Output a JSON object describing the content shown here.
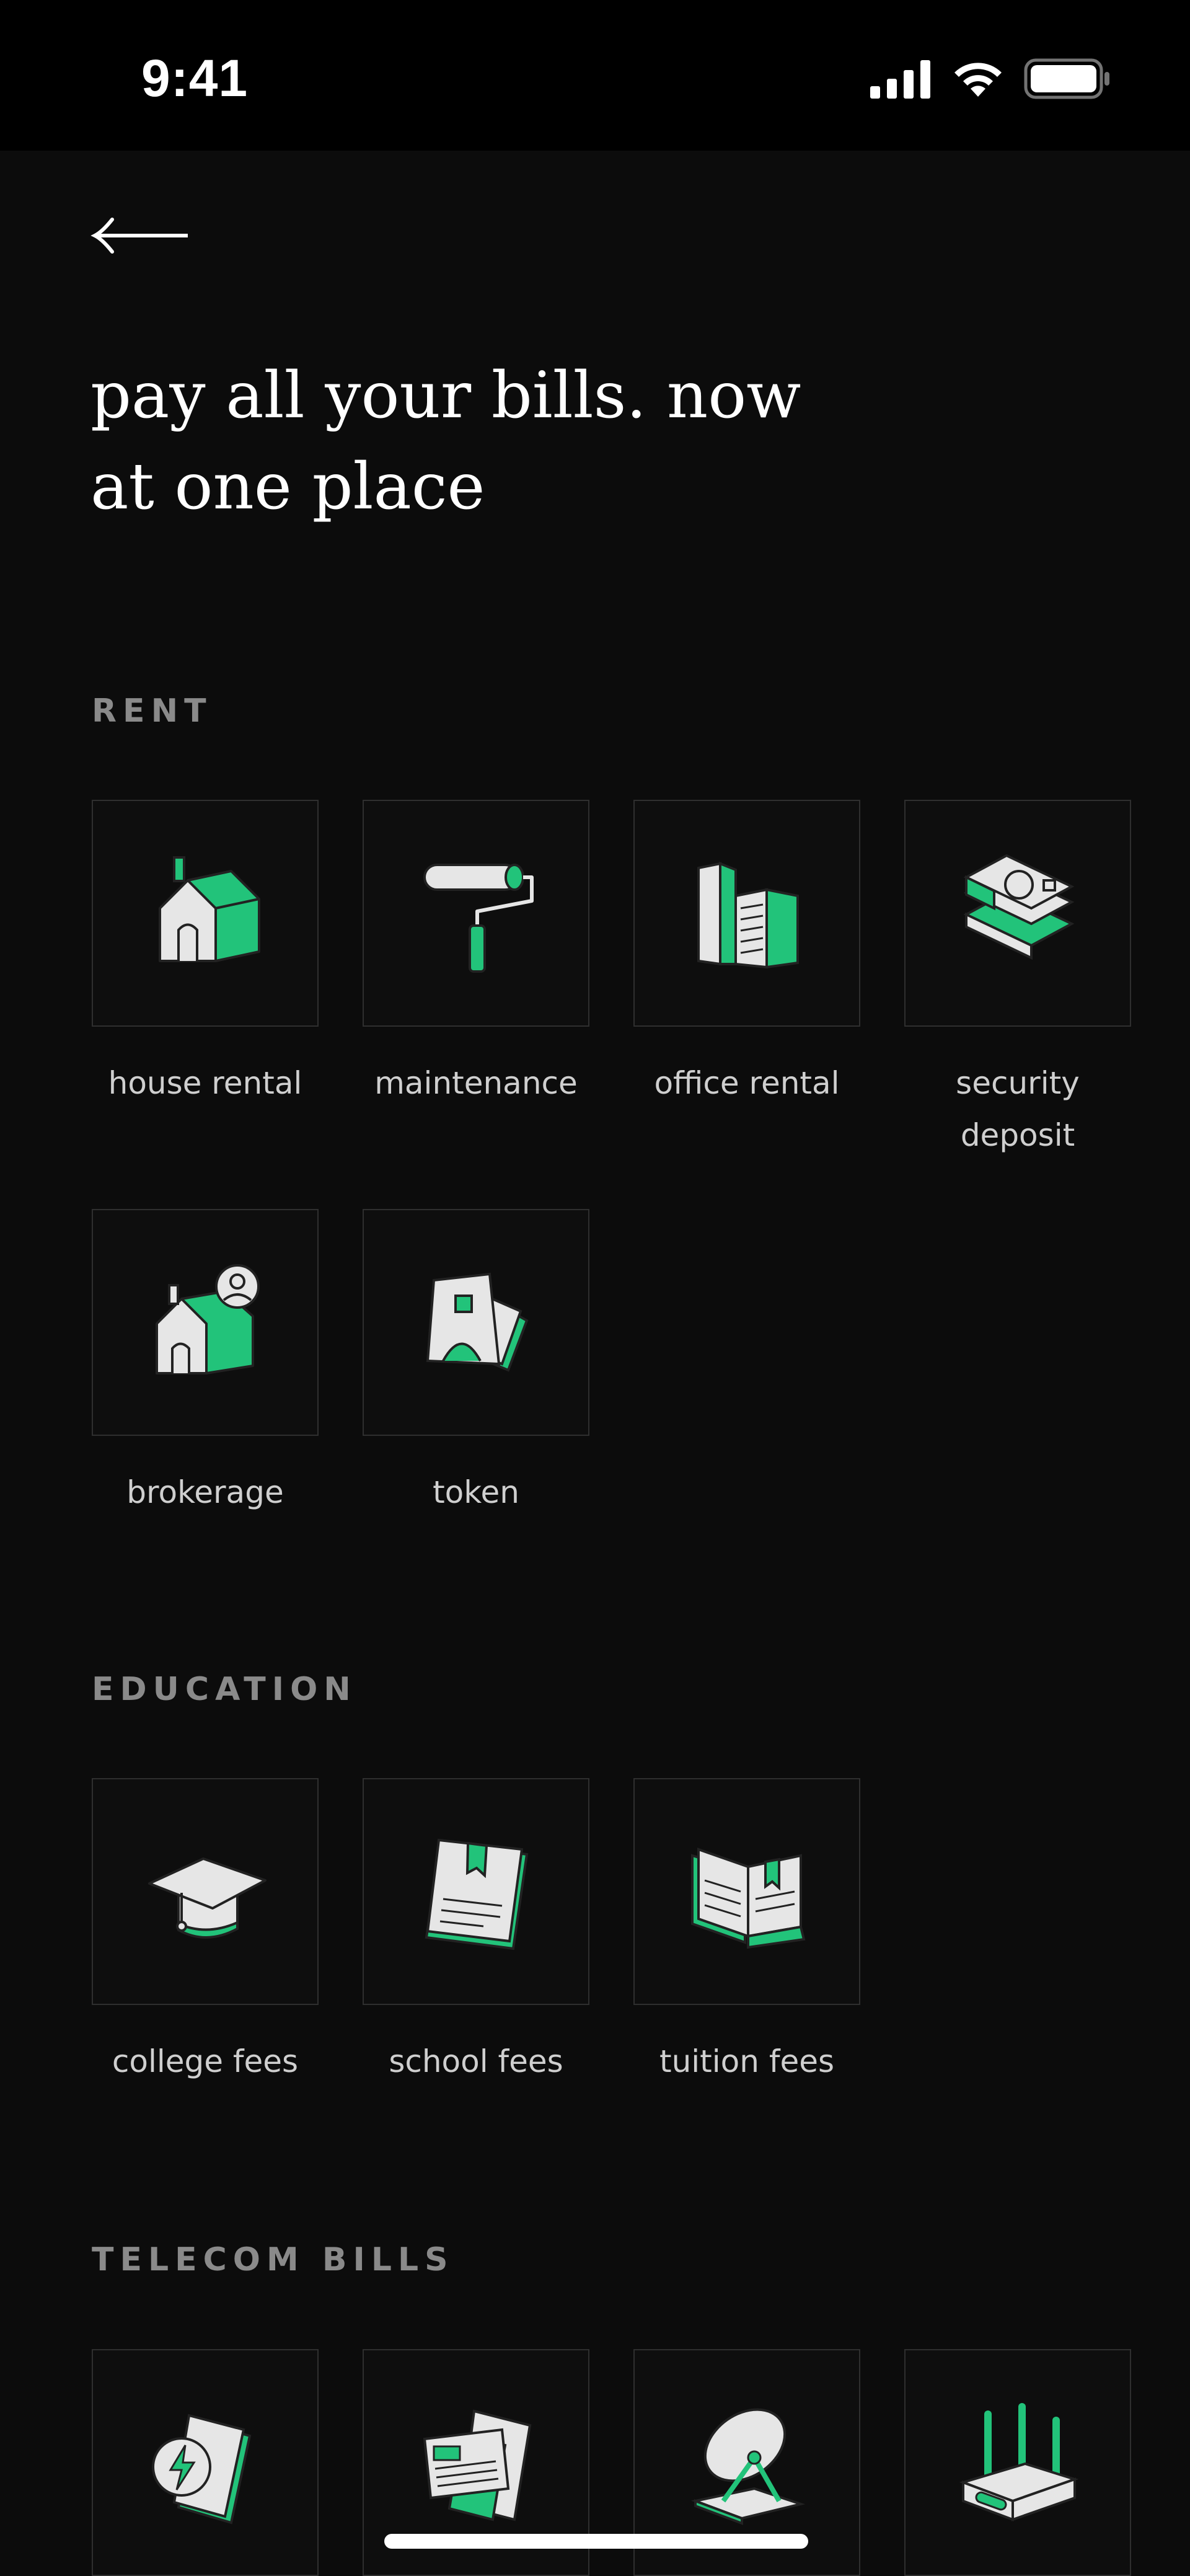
{
  "status_bar": {
    "time": "9:41"
  },
  "header": {
    "back_icon": "arrow-left-icon",
    "headline_line1": "pay all your bills. now",
    "headline_line2": "at one place"
  },
  "sections": {
    "rent": {
      "title": "RENT",
      "items": [
        {
          "label": "house rental",
          "icon": "house-icon"
        },
        {
          "label": "maintenance",
          "icon": "paint-roller-icon"
        },
        {
          "label": "office rental",
          "icon": "office-building-icon"
        },
        {
          "label_line1": "security",
          "label_line2": "deposit",
          "icon": "cash-stack-icon"
        },
        {
          "label": "brokerage",
          "icon": "house-person-icon"
        },
        {
          "label": "token",
          "icon": "token-card-icon"
        }
      ]
    },
    "education": {
      "title": "EDUCATION",
      "items": [
        {
          "label": "college fees",
          "icon": "graduation-cap-icon"
        },
        {
          "label": "school fees",
          "icon": "book-icon"
        },
        {
          "label": "tuition fees",
          "icon": "open-book-icon"
        }
      ]
    },
    "telecom": {
      "title": "TELECOM BILLS",
      "items": [
        {
          "icon": "mobile-recharge-icon"
        },
        {
          "icon": "mobile-bill-icon"
        },
        {
          "icon": "satellite-dish-icon"
        },
        {
          "icon": "router-icon"
        }
      ]
    }
  },
  "colors": {
    "accent": "#22c37a",
    "background": "#0c0c0c",
    "tile_border": "#2f2f2f",
    "label": "#cfcfcf",
    "section_title": "#8a8a8a"
  }
}
